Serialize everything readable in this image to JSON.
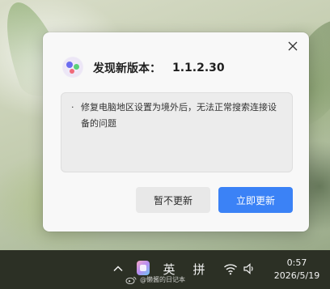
{
  "dialog": {
    "title_label": "发现新版本：",
    "version": "1.1.2.30",
    "release_notes": [
      {
        "bullet": "·",
        "text": "修复电脑地区设置为境外后，无法正常搜索连接设备的问题"
      }
    ],
    "later_button": "暂不更新",
    "update_button": "立即更新"
  },
  "taskbar": {
    "ime_english": "英",
    "ime_pinyin": "拼",
    "time": "0:57",
    "date": "2026/5/19"
  },
  "watermark": {
    "text": "@懒酱的日记本"
  },
  "colors": {
    "accent": "#3b82f6",
    "dialog_bg": "#f8f8f8",
    "taskbar_bg": "#2c3025"
  },
  "icons": {
    "close": "close-icon",
    "logo": "app-logo-icon",
    "tray_chevron": "chevron-up-icon",
    "wifi": "wifi-icon",
    "volume": "volume-icon"
  }
}
